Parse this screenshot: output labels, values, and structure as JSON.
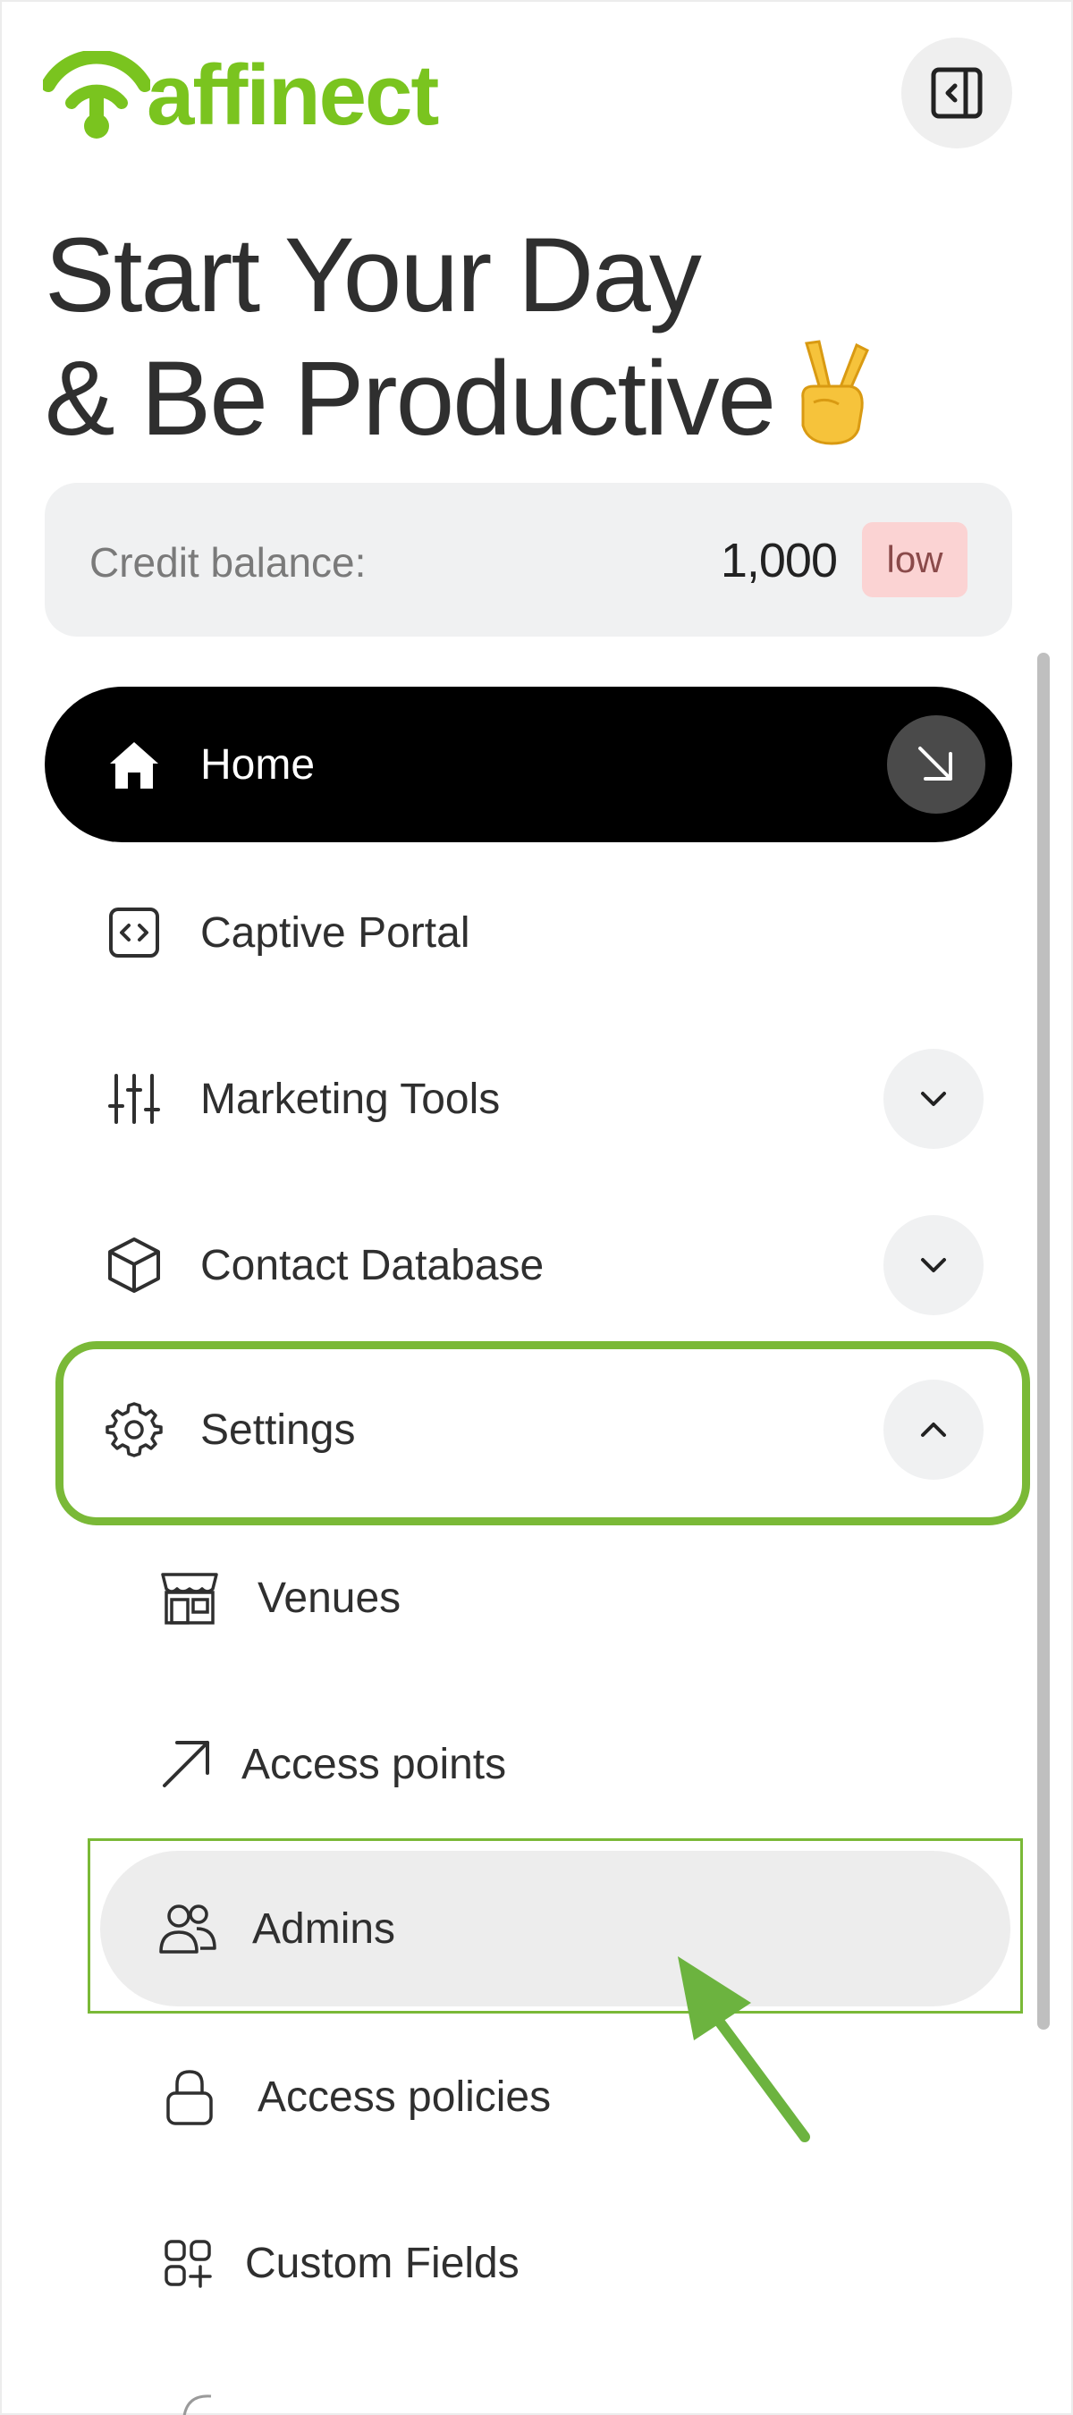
{
  "brand": {
    "name": "affinect",
    "color": "#7ac41f"
  },
  "header": {
    "collapse_icon": "sidebar-collapse-icon"
  },
  "headline": {
    "line1": "Start Your Day",
    "line2": "& Be Productive",
    "emoji": "victory-hand"
  },
  "credit": {
    "label": "Credit balance:",
    "value": "1,000",
    "badge": "low"
  },
  "nav": {
    "home": {
      "label": "Home",
      "icon": "home-icon"
    },
    "captive_portal": {
      "label": "Captive Portal",
      "icon": "code-icon"
    },
    "marketing_tools": {
      "label": "Marketing Tools",
      "icon": "sliders-icon"
    },
    "contact_database": {
      "label": "Contact Database",
      "icon": "cube-icon"
    },
    "settings": {
      "label": "Settings",
      "icon": "gear-icon",
      "expanded": true
    }
  },
  "settings_sub": {
    "venues": {
      "label": "Venues",
      "icon": "storefront-icon"
    },
    "access_points": {
      "label": "Access points",
      "icon": "arrow-up-right-icon"
    },
    "admins": {
      "label": "Admins",
      "icon": "users-icon",
      "selected": true
    },
    "access_policies": {
      "label": "Access policies",
      "icon": "lock-icon"
    },
    "custom_fields": {
      "label": "Custom Fields",
      "icon": "grid-plus-icon"
    }
  },
  "annotation": {
    "highlight_color": "#7ab937"
  }
}
